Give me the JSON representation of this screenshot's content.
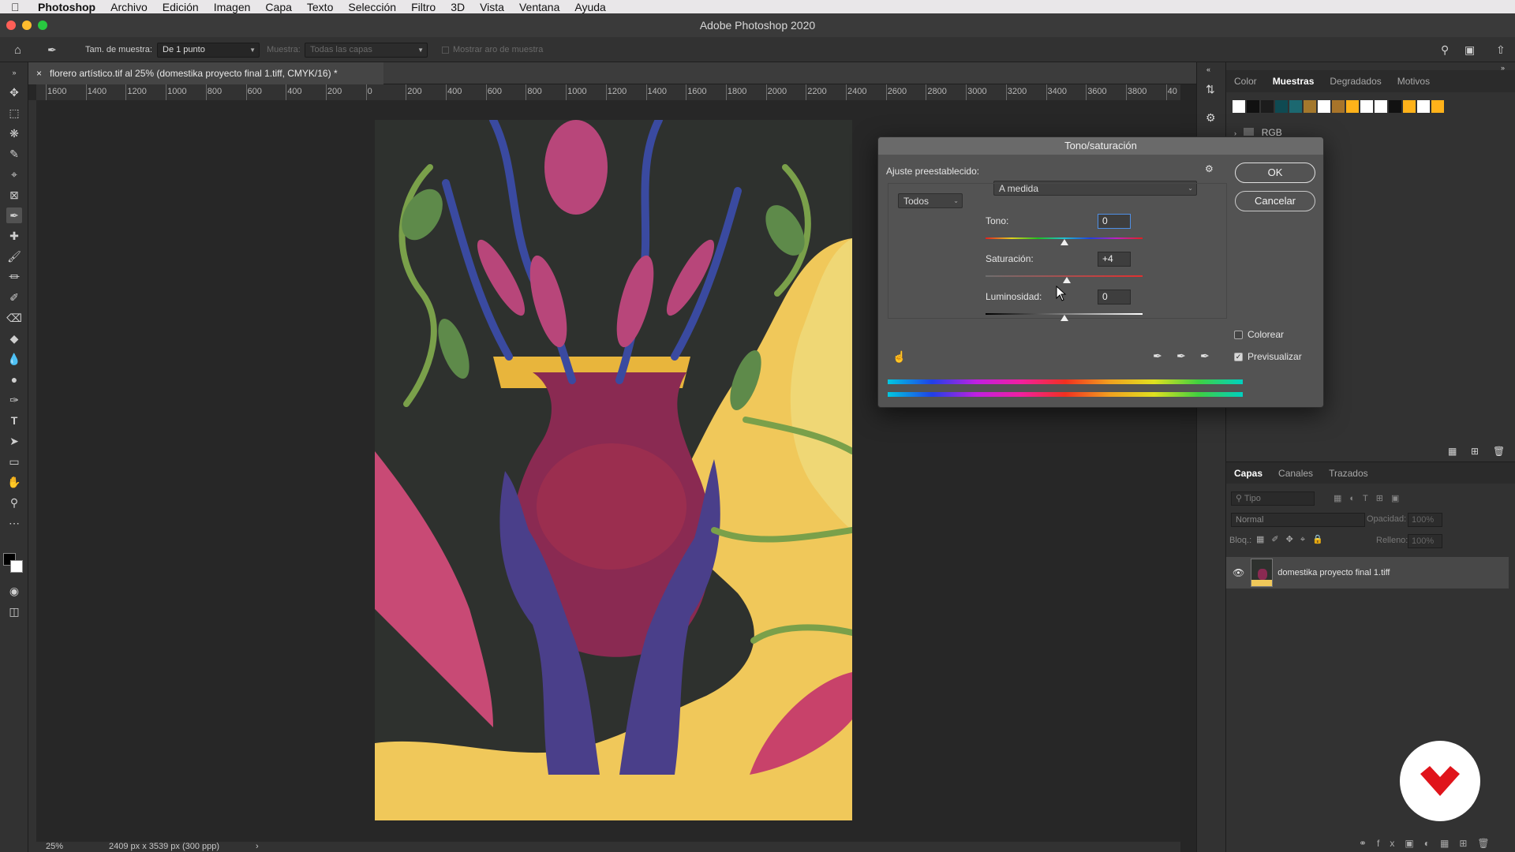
{
  "menubar": {
    "app": "Photoshop",
    "items": [
      "Archivo",
      "Edición",
      "Imagen",
      "Capa",
      "Texto",
      "Selección",
      "Filtro",
      "3D",
      "Vista",
      "Ventana",
      "Ayuda"
    ]
  },
  "window": {
    "title": "Adobe Photoshop 2020"
  },
  "options": {
    "sample_size_label": "Tam. de muestra:",
    "sample_size_value": "De 1 punto",
    "sample_label": "Muestra:",
    "sample_value": "Todas las capas",
    "show_ring_label": "Mostrar aro de muestra"
  },
  "document": {
    "tab_title": "florero artístico.tif al 25% (domestika proyecto final  1.tiff, CMYK/16) *",
    "zoom": "25%",
    "dimensions": "2409 px x 3539 px (300 ppp)"
  },
  "ruler": {
    "top_labels": [
      "1600",
      "1400",
      "1200",
      "1000",
      "800",
      "600",
      "400",
      "200",
      "0",
      "200",
      "400",
      "600",
      "800",
      "1000",
      "1200",
      "1400",
      "1600",
      "1800",
      "2000",
      "2200",
      "2400",
      "2600",
      "2800",
      "3000",
      "3200",
      "3400",
      "3600",
      "3800",
      "40"
    ]
  },
  "panels": {
    "top_tabs": [
      "Color",
      "Muestras",
      "Degradados",
      "Motivos"
    ],
    "active_top_tab": "Muestras",
    "swatch_group": "RGB",
    "swatches": [
      "#ffffff",
      "#111111",
      "#1c1c1c",
      "#0f4a52",
      "#1c6870",
      "#a4782c",
      "#ffffff",
      "#a8742a",
      "#ffb21a",
      "#ffffff",
      "#ffffff",
      "#111111",
      "#ffb21a",
      "#ffffff",
      "#ffb21a"
    ],
    "layer_tabs": [
      "Capas",
      "Canales",
      "Trazados"
    ],
    "active_layer_tab": "Capas",
    "kind_placeholder": "Tipo",
    "blend_mode": "Normal",
    "opacity_label": "Opacidad:",
    "opacity_value": "100%",
    "lock_label": "Bloq.:",
    "fill_label": "Relleno:",
    "fill_value": "100%",
    "layer_name": "domestika proyecto final  1.tiff"
  },
  "dialog": {
    "title": "Tono/saturación",
    "preset_label": "Ajuste preestablecido:",
    "preset_value": "A medida",
    "channel_value": "Todos",
    "ok_label": "OK",
    "cancel_label": "Cancelar",
    "hue_label": "Tono:",
    "hue_value": "0",
    "hue_level": 0,
    "saturation_label": "Saturación:",
    "saturation_value": "+4",
    "saturation_level": 4,
    "lightness_label": "Luminosidad:",
    "lightness_value": "0",
    "lightness_level": 0,
    "colorize_label": "Colorear",
    "colorize_checked": false,
    "preview_label": "Previsualizar",
    "preview_checked": true
  },
  "colors": {
    "accent_blue": "#4f8fe6",
    "brand_red": "#e0141b"
  }
}
